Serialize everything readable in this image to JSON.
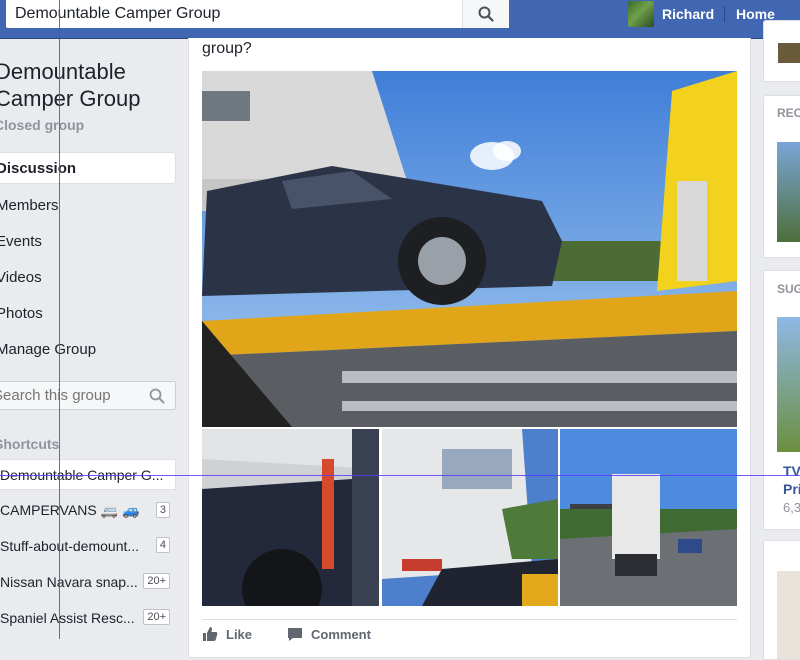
{
  "search": {
    "value": "Demountable Camper Group"
  },
  "header": {
    "profile_name": "Richard",
    "home_label": "Home"
  },
  "group": {
    "title": "Demountable Camper Group",
    "privacy": "Closed group"
  },
  "nav": [
    {
      "label": "Discussion"
    },
    {
      "label": "Members"
    },
    {
      "label": "Events"
    },
    {
      "label": "Videos"
    },
    {
      "label": "Photos"
    },
    {
      "label": "Manage Group"
    }
  ],
  "group_search": {
    "placeholder": "Search this group"
  },
  "shortcuts": {
    "heading": "Shortcuts",
    "items": [
      {
        "label": "Demountable Camper G...",
        "badge": ""
      },
      {
        "label": "CAMPERVANS 🚐 🚙",
        "badge": "3"
      },
      {
        "label": "Stuff-about-demount...",
        "badge": "4"
      },
      {
        "label": "Nissan Navara snap...",
        "badge": "20+"
      },
      {
        "label": "Spaniel Assist Resc...",
        "badge": "20+"
      }
    ]
  },
  "post": {
    "text_fragment": "group?",
    "actions": {
      "like": "Like",
      "comment": "Comment"
    }
  },
  "right_column": {
    "recent_heading": "REC",
    "suggested_heading": "SUG",
    "suggested_title": "TV\nPri",
    "suggested_sub": "6,3"
  }
}
